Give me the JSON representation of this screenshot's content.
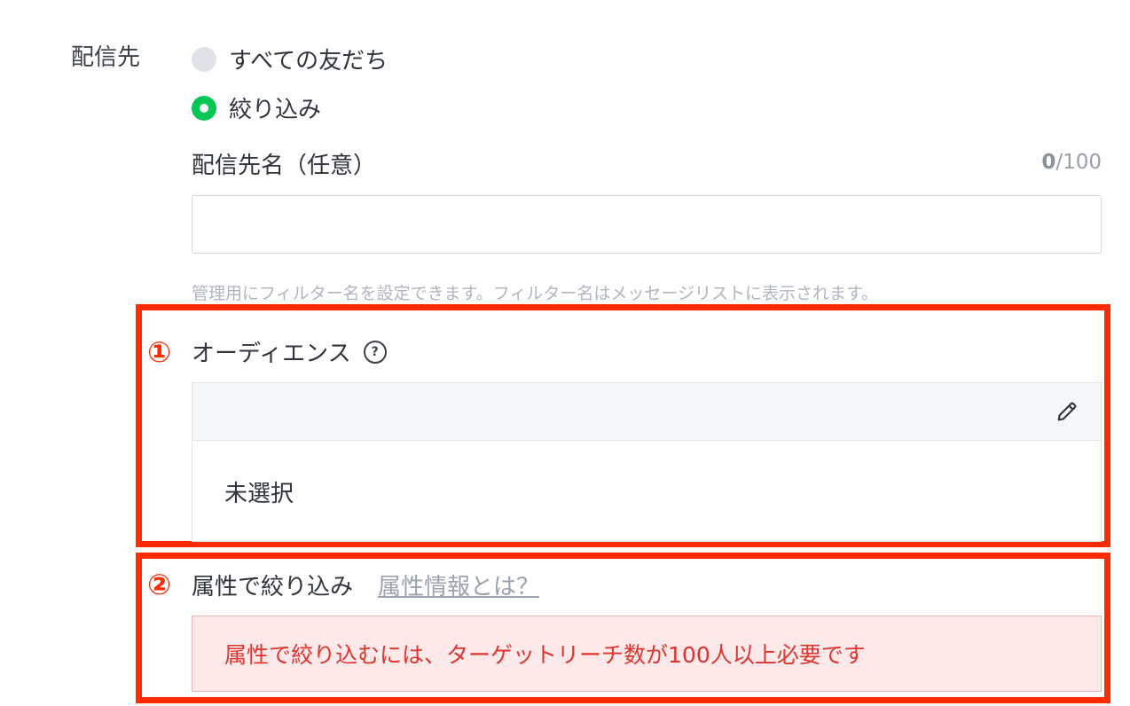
{
  "delivery": {
    "label": "配信先",
    "options": [
      {
        "label": "すべての友だち",
        "selected": false
      },
      {
        "label": "絞り込み",
        "selected": true
      }
    ]
  },
  "name_field": {
    "label": "配信先名（任意）",
    "count": "0",
    "max": "/100",
    "value": "",
    "placeholder": "",
    "help": "管理用にフィルター名を設定できます。フィルター名はメッセージリストに表示されます。"
  },
  "audience": {
    "marker": "①",
    "title": "オーディエンス",
    "help_icon": "question-circle-icon",
    "edit_icon": "pencil-icon",
    "value": "未選択"
  },
  "attributes": {
    "marker": "②",
    "title": "属性で絞り込み",
    "link": "属性情報とは？",
    "warning": "属性で絞り込むには、ターゲットリーチ数が100人以上必要です"
  },
  "colors": {
    "accent_green": "#06c755",
    "highlight_red": "#ff2a00",
    "warning_text": "#e0342f",
    "warning_bg": "#fde9e9"
  }
}
